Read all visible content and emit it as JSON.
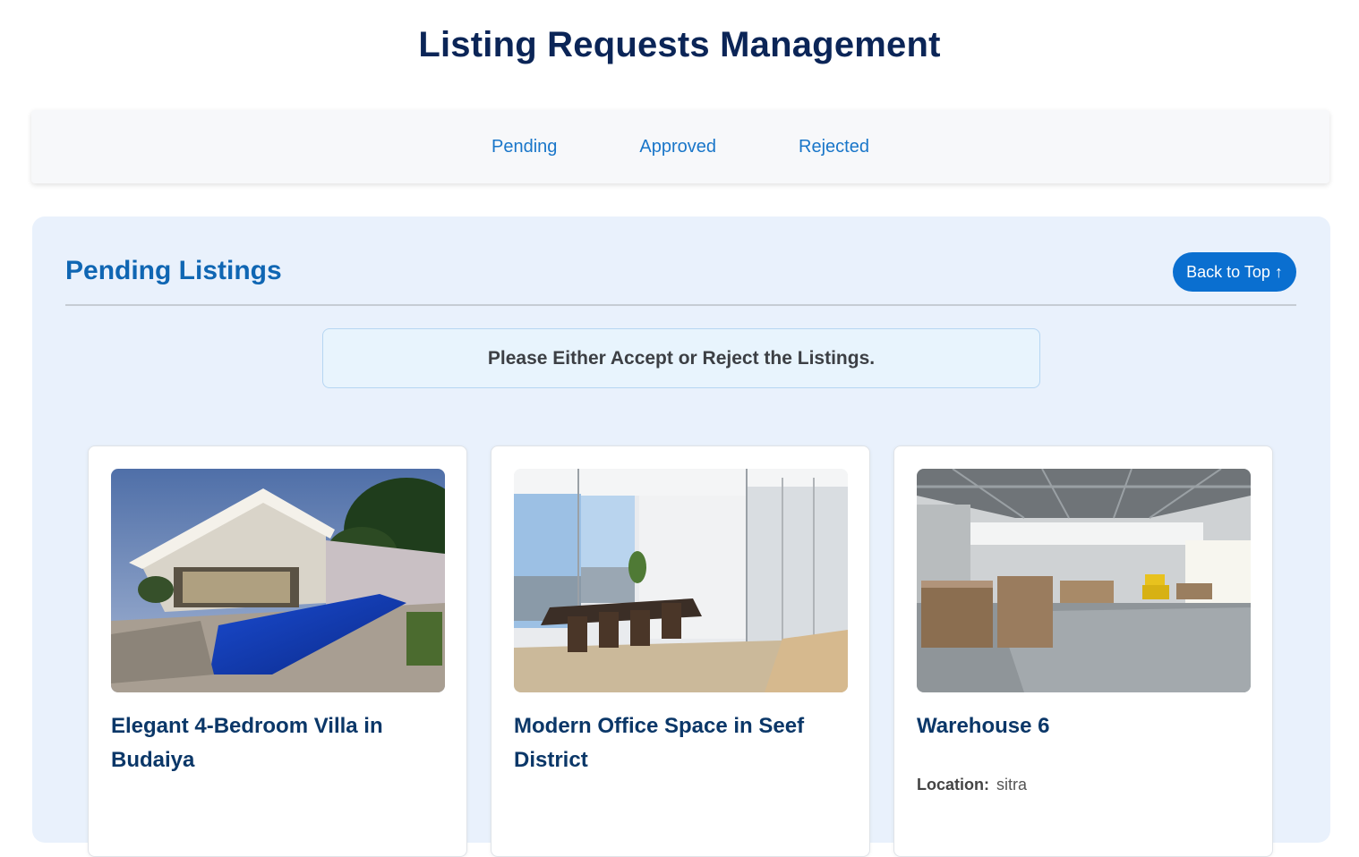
{
  "header": {
    "title": "Listing Requests Management"
  },
  "tabs": [
    {
      "label": "Pending"
    },
    {
      "label": "Approved"
    },
    {
      "label": "Rejected"
    }
  ],
  "section": {
    "title": "Pending Listings",
    "back_to_top": "Back to Top ↑",
    "notice": "Please Either Accept or Reject the Listings."
  },
  "listings": [
    {
      "title": "Elegant 4-Bedroom Villa in Budaiya",
      "image": "villa-pool-photo"
    },
    {
      "title": "Modern Office Space in Seef District",
      "image": "office-meeting-room-photo"
    },
    {
      "title": "Warehouse 6",
      "image": "warehouse-interior-photo",
      "location_label": "Location:",
      "location": "sitra"
    }
  ],
  "colors": {
    "title": "#0b2557",
    "accent": "#0a6fd0",
    "link": "#1976c9",
    "section_bg": "#e9f1fc"
  }
}
